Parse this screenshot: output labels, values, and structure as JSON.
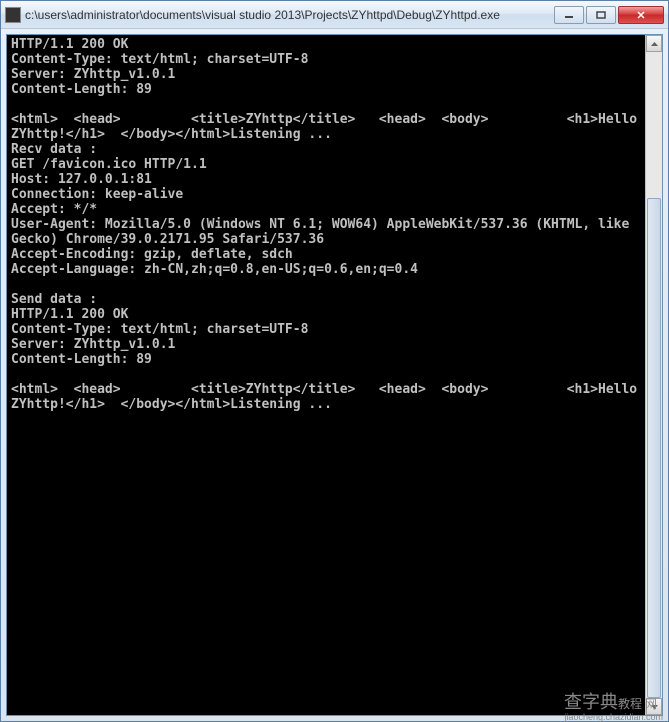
{
  "window": {
    "title": "c:\\users\\administrator\\documents\\visual studio 2013\\Projects\\ZYhttpd\\Debug\\ZYhttpd.exe"
  },
  "console": {
    "lines": [
      "HTTP/1.1 200 OK",
      "Content-Type: text/html; charset=UTF-8",
      "Server: ZYhttp_v1.0.1",
      "Content-Length: 89",
      "",
      "<html>  <head>         <title>ZYhttp</title>   <head>  <body>          <h1>Hello ZYhttp!</h1>  </body></html>Listening ...",
      "Recv data :",
      "GET /favicon.ico HTTP/1.1",
      "Host: 127.0.0.1:81",
      "Connection: keep-alive",
      "Accept: */*",
      "User-Agent: Mozilla/5.0 (Windows NT 6.1; WOW64) AppleWebKit/537.36 (KHTML, like Gecko) Chrome/39.0.2171.95 Safari/537.36",
      "Accept-Encoding: gzip, deflate, sdch",
      "Accept-Language: zh-CN,zh;q=0.8,en-US;q=0.6,en;q=0.4",
      "",
      "Send data :",
      "HTTP/1.1 200 OK",
      "Content-Type: text/html; charset=UTF-8",
      "Server: ZYhttp_v1.0.1",
      "Content-Length: 89",
      "",
      "<html>  <head>         <title>ZYhttp</title>   <head>  <body>          <h1>Hello ZYhttp!</h1>  </body></html>Listening ..."
    ]
  },
  "watermark": {
    "main": "查字典",
    "suffix": "教程 网",
    "url": "jiaocheng.chazidian.com"
  }
}
